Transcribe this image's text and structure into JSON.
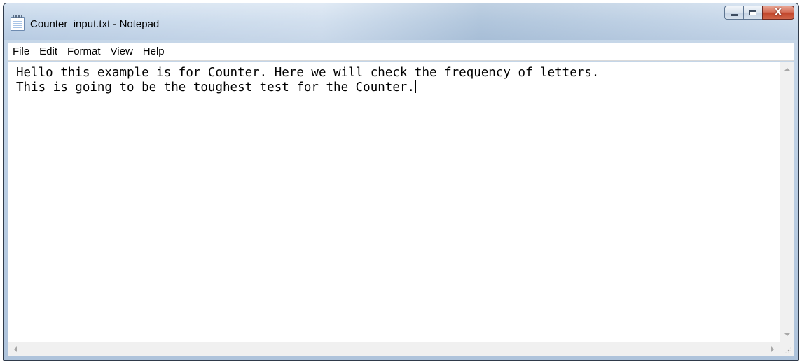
{
  "window": {
    "title": "Counter_input.txt - Notepad",
    "app_icon": "notepad-icon",
    "controls": {
      "minimize_icon": "minimize-icon",
      "maximize_icon": "maximize-icon",
      "close_icon": "close-icon",
      "close_glyph": "X"
    }
  },
  "menu": {
    "items": [
      {
        "label": "File"
      },
      {
        "label": "Edit"
      },
      {
        "label": "Format"
      },
      {
        "label": "View"
      },
      {
        "label": "Help"
      }
    ]
  },
  "editor": {
    "lines": [
      "Hello this example is for Counter. Here we will check the frequency of letters.",
      "This is going to be the toughest test for the Counter."
    ]
  },
  "colors": {
    "titlebar": "#c3d5e9",
    "close_button": "#c2452b",
    "editor_background": "#ffffff"
  }
}
